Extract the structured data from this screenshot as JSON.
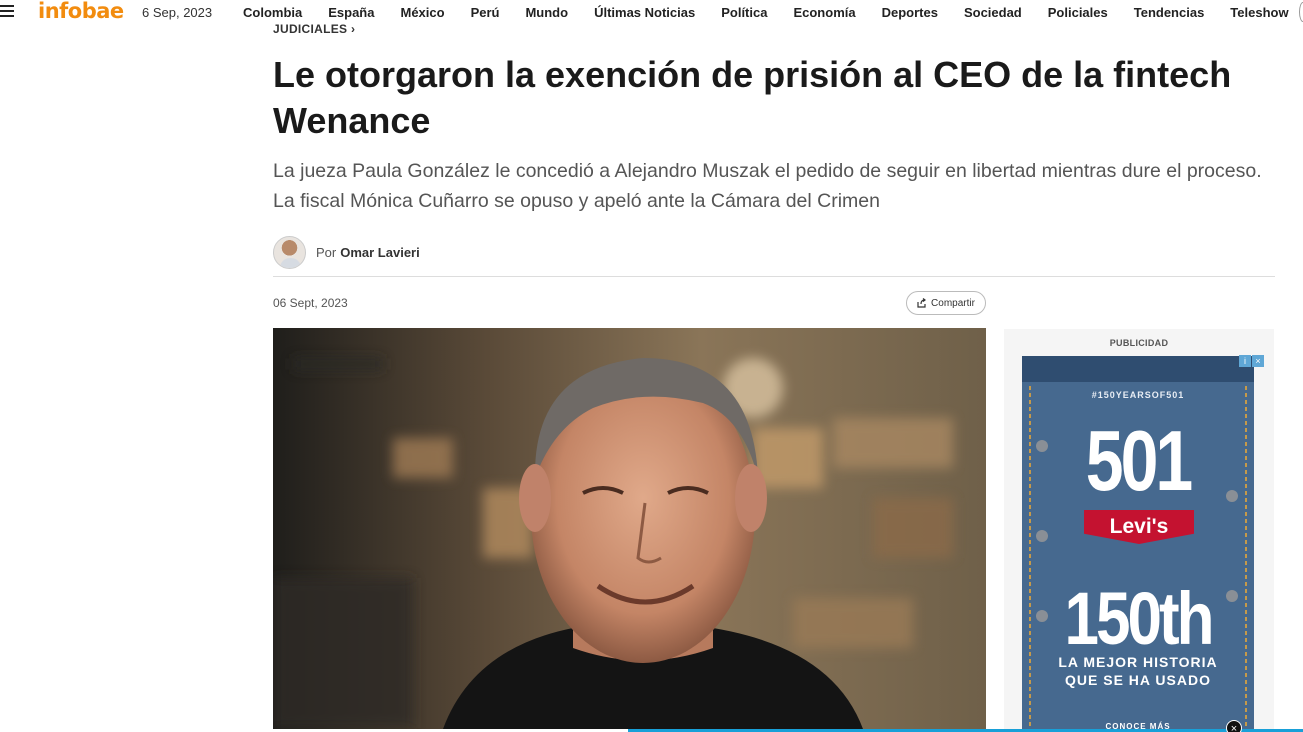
{
  "header": {
    "logo": "infobae",
    "date": "6 Sep, 2023",
    "nav": [
      "Colombia",
      "España",
      "México",
      "Perú",
      "Mundo",
      "Últimas Noticias",
      "Política",
      "Economía",
      "Deportes",
      "Sociedad",
      "Policiales",
      "Tendencias",
      "Teleshow"
    ]
  },
  "article": {
    "kicker": "JUDICIALES ›",
    "title": "Le otorgaron la exención de prisión al CEO de la fintech Wenance",
    "subtitle": "La jueza Paula González le concedió a Alejandro Muszak el pedido de seguir en libertad mientras dure el proceso. La fiscal Mónica Cuñarro se opuso y apeló ante la Cámara del Crimen",
    "author_prefix": "Por",
    "author_name": "Omar Lavieri",
    "date": "06 Sept, 2023",
    "share_label": "Compartir"
  },
  "ad": {
    "label": "PUBLICIDAD",
    "hashtag": "#150YEARSOF501",
    "model": "501",
    "brand": "Levi's",
    "years": "150th",
    "line1": "LA MEJOR HISTORIA",
    "line2": "QUE SE HA USADO",
    "cta": "CONOCE MÁS",
    "badge_info": "i",
    "badge_close": "×",
    "close_button": "×"
  },
  "colors": {
    "brand": "#f28c0f",
    "ad_levis": "#c41230",
    "strip": "#18a0d8"
  }
}
